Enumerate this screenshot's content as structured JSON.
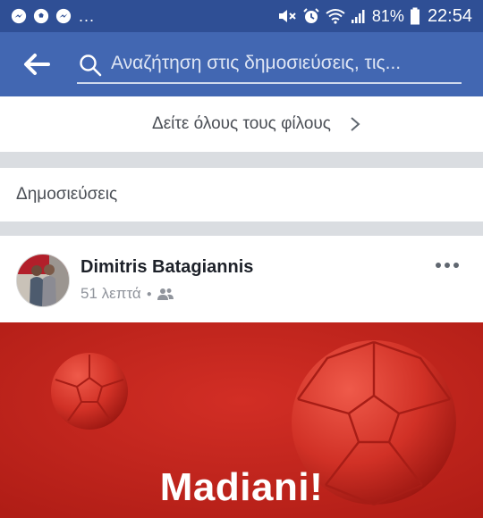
{
  "status_bar": {
    "notification_icons": [
      "messenger-icon",
      "soccer-ball-icon",
      "messenger-icon"
    ],
    "overflow_indicator": "...",
    "system_icons": [
      "mute-icon",
      "alarm-icon",
      "wifi-icon",
      "signal-icon"
    ],
    "battery_percent": "81%",
    "time": "22:54"
  },
  "header": {
    "search_placeholder": "Αναζήτηση στις δημοσιεύσεις, τις..."
  },
  "friends_link": {
    "label": "Δείτε όλους τους φίλους"
  },
  "posts_section": {
    "title": "Δημοσιεύσεις"
  },
  "post": {
    "author": "Dimitris Batagiannis",
    "time": "51 λεπτά",
    "audience_icon": "friends-icon",
    "image_caption": "Madiani!"
  },
  "colors": {
    "status_bar": "#2f4f95",
    "header": "#4267b2",
    "divider": "#dadde1",
    "post_image_bg": "#c3241c"
  }
}
